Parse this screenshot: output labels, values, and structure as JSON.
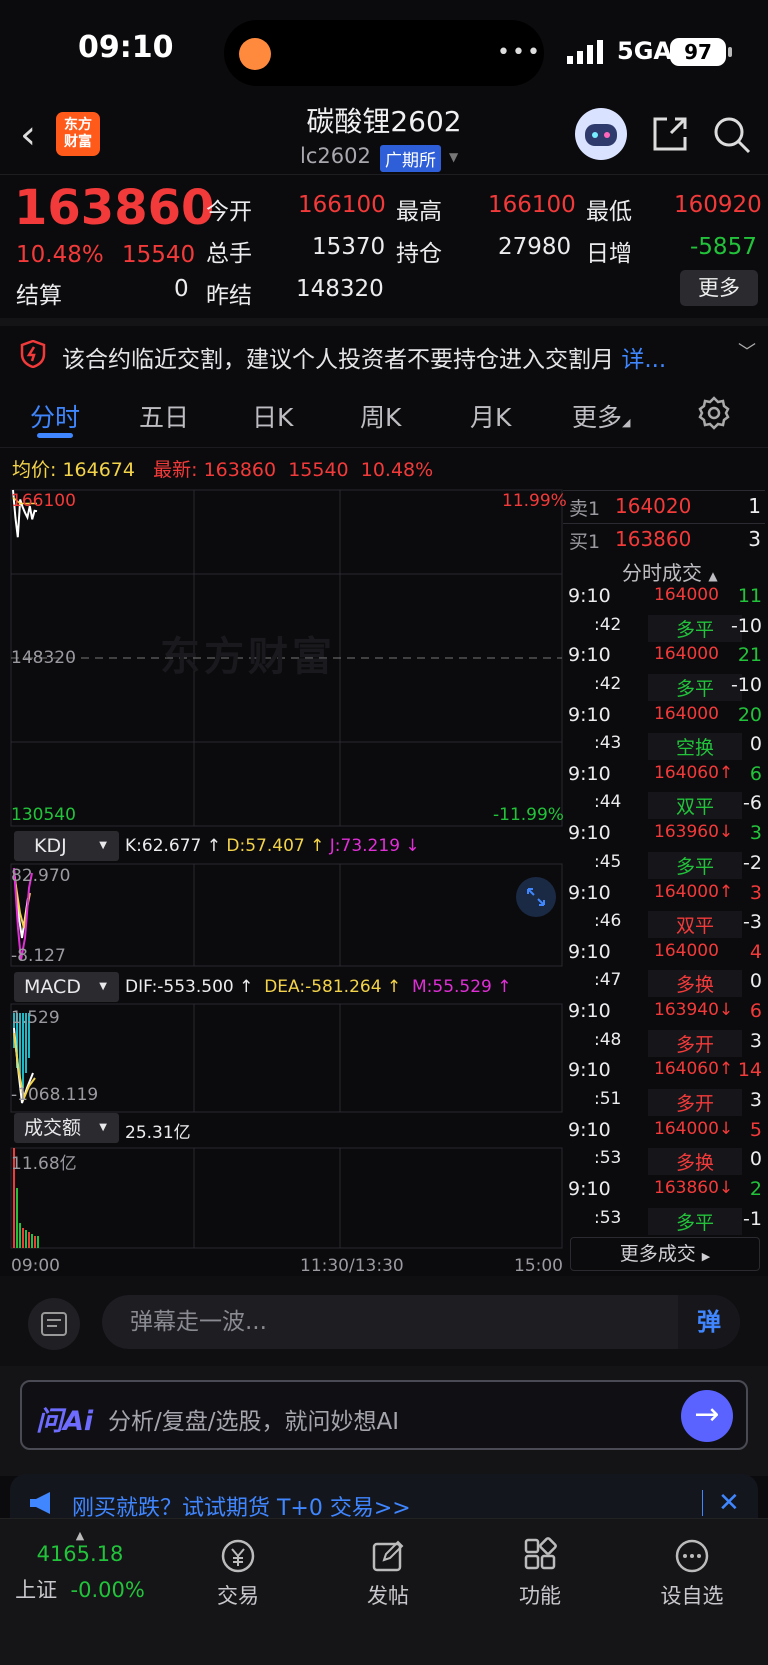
{
  "status_bar": {
    "time": "09:10",
    "network": "5GA",
    "battery": "97"
  },
  "header": {
    "back_icon": "chevron-left-icon",
    "logo_text_1": "东方",
    "logo_text_2": "财富",
    "title": "碳酸锂2602",
    "code": "lc2602",
    "exchange": "广期所"
  },
  "quote": {
    "price": "163860",
    "change_pct": "10.48%",
    "change": "15540",
    "open_label": "今开",
    "open": "166100",
    "high_label": "最高",
    "high": "166100",
    "low_label": "最低",
    "low": "160920",
    "volume_label": "总手",
    "volume": "15370",
    "oi_label": "持仓",
    "oi": "27980",
    "daily_inc_label": "日增",
    "daily_inc": "-5857",
    "settle_label": "结算",
    "settle": "0",
    "prev_settle_label": "昨结",
    "prev_settle": "148320",
    "more_button": "更多"
  },
  "notice": {
    "text": "该合约临近交割，建议个人投资者不要持仓进入交割月",
    "link": "详..."
  },
  "tabs": [
    "分时",
    "五日",
    "日K",
    "周K",
    "月K",
    "更多"
  ],
  "avg_bar": {
    "avg_label": "均价:",
    "avg": "164674",
    "latest_label": "最新:",
    "latest": "163860",
    "change": "15540",
    "pct": "10.48%"
  },
  "chart": {
    "upper": "166100",
    "upper_pct": "11.99%",
    "mid": "148320",
    "lower": "130540",
    "lower_pct": "-11.99%",
    "watermark": "东方财富",
    "kdj_label": "KDJ",
    "kdj_k": "K:62.677 ↑",
    "kdj_d": "D:57.407 ↑",
    "kdj_j": "J:73.219 ↓",
    "kdj_top": "82.970",
    "kdj_bottom": "-8.127",
    "macd_label": "MACD",
    "macd_dif": "DIF:-553.500 ↑",
    "macd_dea": "DEA:-581.264 ↑",
    "macd_m": "M:55.529 ↑",
    "macd_top": "1.529",
    "macd_bottom": "-1068.119",
    "vol_label": "成交额",
    "vol_total": "25.31亿",
    "vol_top": "11.68亿",
    "x_start": "09:00",
    "x_mid": "11:30/13:30",
    "x_end": "15:00"
  },
  "chart_data": {
    "type": "line",
    "x": [
      "09:00",
      "09:01",
      "09:02",
      "09:03",
      "09:04",
      "09:05",
      "09:06",
      "09:07",
      "09:08",
      "09:09",
      "09:10"
    ],
    "series": [
      {
        "values": [
          166100,
          163200,
          161100,
          165100,
          164300,
          163700,
          163200,
          164400,
          163000,
          163900,
          163860
        ]
      }
    ],
    "ylim": [
      130540,
      166100
    ],
    "xlabel": "",
    "ylabel": ""
  },
  "orderbook": {
    "sell_label": "卖1",
    "sell_price": "164020",
    "sell_qty": "1",
    "buy_label": "买1",
    "buy_price": "163860",
    "buy_qty": "3"
  },
  "trades_header": "分时成交",
  "trades": [
    {
      "time": "9:10",
      "price": "164000",
      "qty": "11",
      "sec": ":42",
      "type": "多平",
      "diff": "-10",
      "pc": "red",
      "qc": "green",
      "tc": "green"
    },
    {
      "time": "9:10",
      "price": "164000",
      "qty": "21",
      "sec": ":42",
      "type": "多平",
      "diff": "-10",
      "pc": "red",
      "qc": "green",
      "tc": "green"
    },
    {
      "time": "9:10",
      "price": "164000",
      "qty": "20",
      "sec": ":43",
      "type": "空换",
      "diff": "0",
      "pc": "red",
      "qc": "green",
      "tc": "green"
    },
    {
      "time": "9:10",
      "price": "164060↑",
      "qty": "6",
      "sec": ":44",
      "type": "双平",
      "diff": "-6",
      "pc": "red",
      "qc": "green",
      "tc": "green"
    },
    {
      "time": "9:10",
      "price": "163960↓",
      "qty": "3",
      "sec": ":45",
      "type": "多平",
      "diff": "-2",
      "pc": "red",
      "qc": "green",
      "tc": "green"
    },
    {
      "time": "9:10",
      "price": "164000↑",
      "qty": "3",
      "sec": ":46",
      "type": "双平",
      "diff": "-3",
      "pc": "red",
      "qc": "red",
      "tc": "red"
    },
    {
      "time": "9:10",
      "price": "164000",
      "qty": "4",
      "sec": ":47",
      "type": "多换",
      "diff": "0",
      "pc": "red",
      "qc": "red",
      "tc": "red"
    },
    {
      "time": "9:10",
      "price": "163940↓",
      "qty": "6",
      "sec": ":48",
      "type": "多开",
      "diff": "3",
      "pc": "red",
      "qc": "red",
      "tc": "red"
    },
    {
      "time": "9:10",
      "price": "164060↑",
      "qty": "14",
      "sec": ":51",
      "type": "多开",
      "diff": "3",
      "pc": "red",
      "qc": "red",
      "tc": "red"
    },
    {
      "time": "9:10",
      "price": "164000↓",
      "qty": "5",
      "sec": ":53",
      "type": "多换",
      "diff": "0",
      "pc": "red",
      "qc": "red",
      "tc": "red"
    },
    {
      "time": "9:10",
      "price": "163860↓",
      "qty": "2",
      "sec": ":53",
      "type": "多平",
      "diff": "-1",
      "pc": "red",
      "qc": "green",
      "tc": "green"
    }
  ],
  "more_trades": "更多成交",
  "danmaku": {
    "placeholder": "弹幕走一波...",
    "button": "弹"
  },
  "ai": {
    "logo": "问Ai",
    "placeholder": "分析/复盘/选股，就问妙想AI"
  },
  "promo": {
    "text": "刚买就跌？试试期货 T+0 交易>>"
  },
  "nav": {
    "index_value": "4165.18",
    "index_name": "上证",
    "index_pct": "-0.00%",
    "trade": "交易",
    "post": "发帖",
    "func": "功能",
    "watch": "设自选"
  }
}
